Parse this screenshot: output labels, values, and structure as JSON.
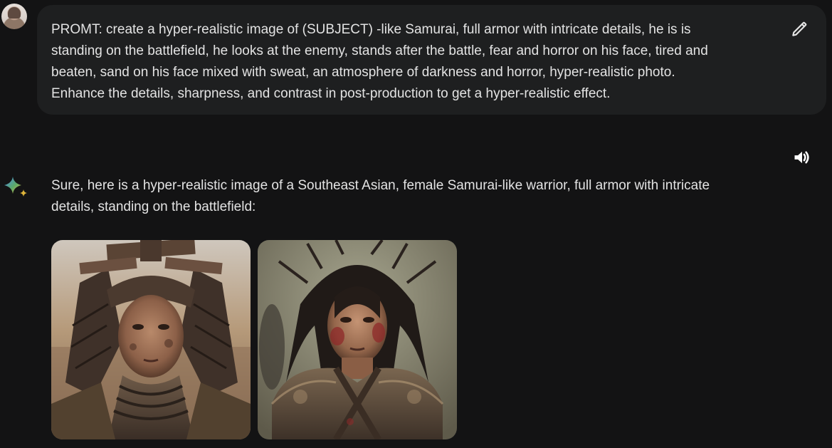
{
  "user_message": {
    "lines": [
      "PROMT: create a hyper-realistic image of (SUBJECT) -like Samurai, full armor with intricate details, he is is",
      "standing on the battlefield, he looks at the enemy, stands after the battle, fear and horror on his face, tired and",
      "beaten, sand on his face mixed with sweat, an atmosphere of darkness and horror, hyper-realistic photo.",
      "Enhance the details, sharpness, and contrast in post-production to get a hyper-realistic effect."
    ],
    "edit_icon": "pencil-icon"
  },
  "response": {
    "lines": [
      "Sure, here is a hyper-realistic image of a Southeast Asian, female Samurai-like warrior, full armor with intricate",
      "details, standing on the battlefield:"
    ],
    "speaker_icon": "speaker-icon",
    "model_icon": "gemini-sparkle-icon",
    "images": [
      {
        "icon": "generated-image-samurai-helmet"
      },
      {
        "icon": "generated-image-warrior-hair"
      }
    ]
  },
  "colors": {
    "background": "#131314",
    "bubble": "#1e1f20",
    "text": "#e3e3e3",
    "sparkle_blue": "#4285f4",
    "sparkle_yellow": "#f4b400"
  }
}
